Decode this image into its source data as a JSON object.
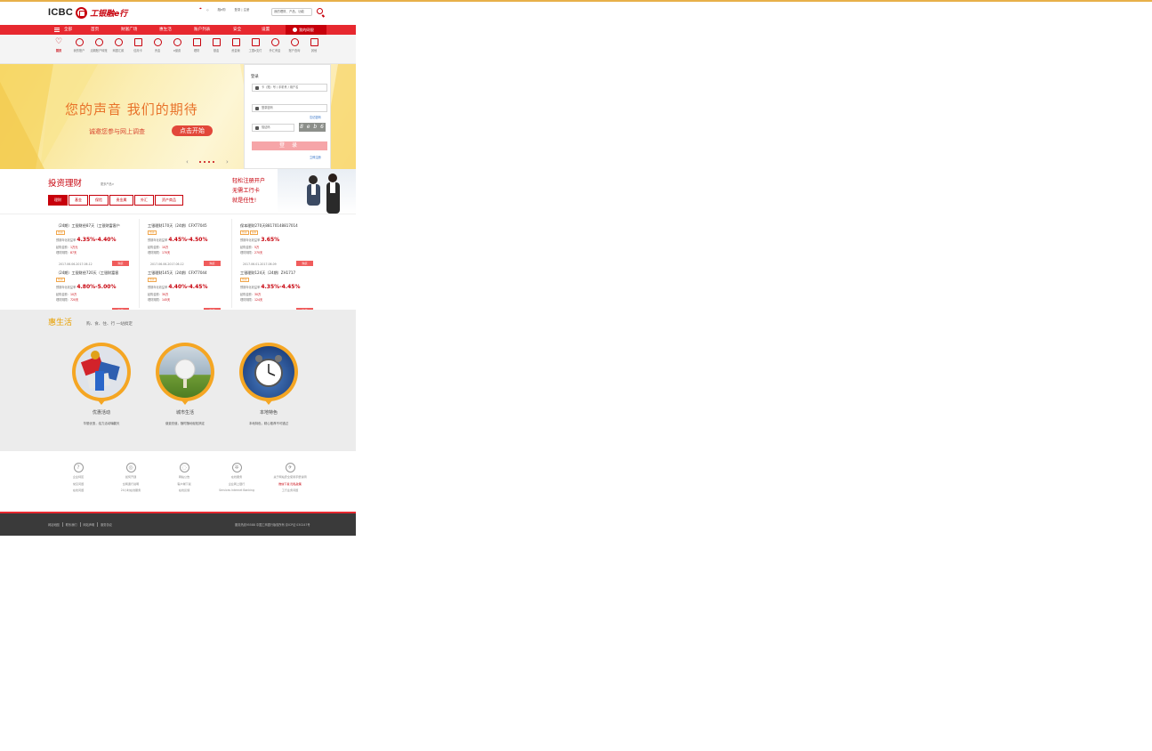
{
  "header": {
    "logo_en": "ICBC",
    "logo_cn": "工银融e行",
    "lang": "◇",
    "links": [
      "融e购",
      "登录 | 注册"
    ],
    "search_placeholder": "我的理财、产品、功能"
  },
  "nav": {
    "items": [
      "全部",
      "首页",
      "财富广场",
      "惠生活",
      "账户列表",
      "安全",
      "设置"
    ],
    "my_label": "我的网银"
  },
  "quick": {
    "items": [
      "首页",
      "我的账户",
      "活期账户转账",
      "网银汇款",
      "信用卡",
      "贵金",
      "e缴费",
      "理财",
      "基金",
      "资金管",
      "工银e支付",
      "外汇黄金",
      "账户查询",
      "其他"
    ]
  },
  "banner": {
    "title": "您的声音  我们的期待",
    "subtitle": "诚邀您参与网上调查",
    "cta": "点击开始",
    "prev": "‹",
    "next": "›"
  },
  "login": {
    "title": "登录",
    "user_placeholder": "卡（账）号 / 手机号 / 用户名",
    "pwd_placeholder": "登录密码",
    "forgot": "忘记密码",
    "captcha_placeholder": "验证码",
    "captcha_text": "8 e b 6",
    "submit": "登 录",
    "register": "立即注册"
  },
  "invest": {
    "title": "投资理财",
    "more": "更多产品>",
    "tabs": [
      "理财",
      "基金",
      "保险",
      "贵金属",
      "外汇",
      "资产商品"
    ],
    "promo": [
      "轻松注册开户",
      "无需工行卡",
      "就是任性!"
    ]
  },
  "products": [
    {
      "name": "（24期）工银财经87天（工银财富客户",
      "tags": [
        "热销"
      ],
      "rate_label": "预期年化收益率",
      "rate": "4.35%-4.40%",
      "min_label": "起购金额：",
      "min": "1万元",
      "term_label": "理财期限：",
      "term": "87天",
      "date": "2017.06.06-2017.06.12",
      "btn": "购买"
    },
    {
      "name": "工银理财170天（24期）CFXT7045",
      "tags": [
        "热销"
      ],
      "rate_label": "预期年化收益率",
      "rate": "4.45%-4.50%",
      "min_label": "起购金额：",
      "min": "10万",
      "term_label": "理财期限：",
      "term": "170天",
      "date": "2017.06.06-2017.06.12",
      "btn": "购买"
    },
    {
      "name": "保本理财270天88170148817014",
      "tags": [
        "热销",
        "保本"
      ],
      "rate_label": "预期年化收益率",
      "rate": "3.65%",
      "min_label": "起购金额：",
      "min": "5万",
      "term_label": "理财期限：",
      "term": "270天",
      "date": "2017.06.01-2017.06.09",
      "btn": "购买"
    },
    {
      "name": "（24期）工银财经720天（工银财富客",
      "tags": [
        "热销"
      ],
      "rate_label": "预期年化收益率",
      "rate": "4.80%-5.00%",
      "min_label": "起购金额：",
      "min": "10万",
      "term_label": "理财期限：",
      "term": "720天",
      "date": "2017.06.02-2017.06.06",
      "btn": "购买"
    },
    {
      "name": "工银理财145天（24期）CFXT7044",
      "tags": [
        "热销"
      ],
      "rate_label": "预期年化收益率",
      "rate": "4.40%-4.45%",
      "min_label": "起购金额：",
      "min": "30万",
      "term_label": "理财期限：",
      "term": "145天",
      "date": "2017.06.02-2017.06.06",
      "btn": "购买"
    },
    {
      "name": "工银理财124天（24期）ZH1717",
      "tags": [
        "热销"
      ],
      "rate_label": "预期年化收益率",
      "rate": "4.35%-4.45%",
      "min_label": "起购金额：",
      "min": "30万",
      "term_label": "理财期限：",
      "term": "124天",
      "date": "2017.06.02-2017.06.06",
      "btn": "购买"
    }
  ],
  "life": {
    "title": "惠生活",
    "subtitle": "购、食、住、行 一站搞定",
    "items": [
      {
        "name": "优惠活动",
        "desc": "华丽优惠，给力活动嗨翻天"
      },
      {
        "name": "城市生活",
        "desc": "缴费充值，随时随地轻松搞定"
      },
      {
        "name": "本地特色",
        "desc": "本地特色，精心推荐不可错过"
      }
    ]
  },
  "services": [
    {
      "icon": "?",
      "lines": [
        "企业特区",
        "常见问题",
        "在线问题"
      ]
    },
    {
      "icon": "◎",
      "lines": [
        "如何开通",
        "全网通行说明",
        "24小时在线服务"
      ]
    },
    {
      "icon": "◌",
      "lines": [
        "网站公告",
        "客户端下载",
        "在线反馈"
      ]
    },
    {
      "icon": "✲",
      "lines": [
        "在线服务",
        "企业网上银行",
        "Services Internet Banking"
      ]
    },
    {
      "icon": "✈",
      "lines": [
        "关于网站安全使用手册说明",
        "微信下载 隐私政策",
        "工行业务问题"
      ],
      "link": "隐私政策"
    }
  ],
  "footer": {
    "links": [
      "网站地图",
      "联系我们",
      "网站声明",
      "服务协议"
    ],
    "right": "服务热线95588   中国工商银行版权所有   京ICP证 030247号"
  }
}
